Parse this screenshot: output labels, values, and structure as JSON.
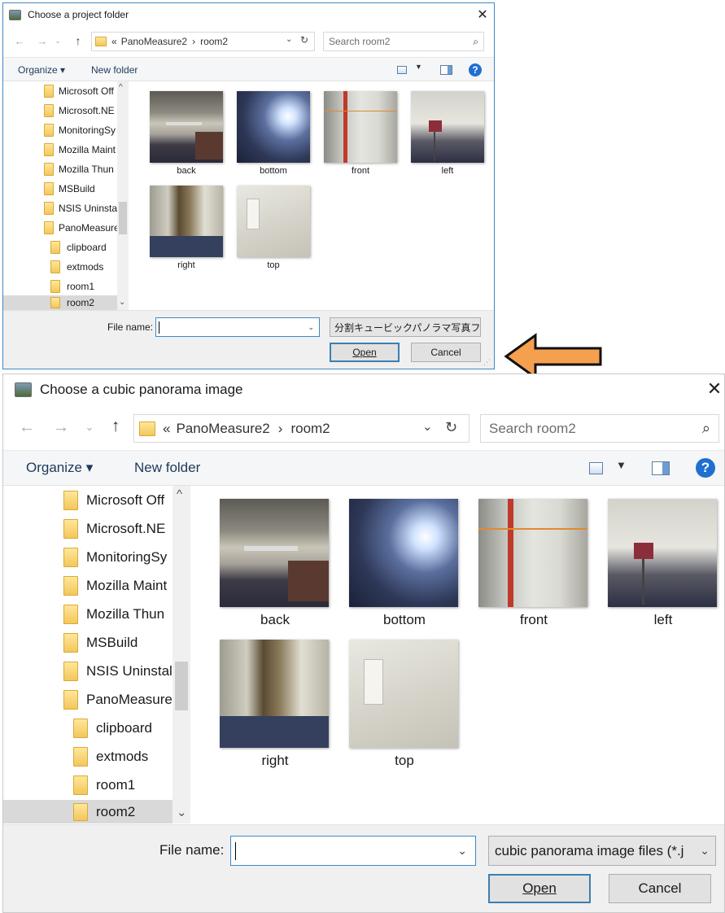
{
  "dialog_small": {
    "title": "Choose a project folder",
    "breadcrumb": [
      "«",
      "PanoMeasure2",
      "›",
      "room2"
    ],
    "search_placeholder": "Search room2",
    "toolbar": {
      "organize": "Organize ▾",
      "new_folder": "New folder"
    },
    "tree": [
      "Microsoft Off",
      "Microsoft.NE",
      "MonitoringSy",
      "Mozilla Maint",
      "Mozilla Thun",
      "MSBuild",
      "NSIS Uninstal",
      "PanoMeasure",
      "clipboard",
      "extmods",
      "room1",
      "room2"
    ],
    "files": [
      "back",
      "bottom",
      "front",
      "left",
      "right",
      "top"
    ],
    "filename_label": "File name:",
    "filename_value": "",
    "filetype": "分割キュービックパノラマ写真ファ",
    "open": "Open",
    "cancel": "Cancel"
  },
  "dialog_large": {
    "title": "Choose a cubic panorama image",
    "breadcrumb": [
      "«",
      "PanoMeasure2",
      "›",
      "room2"
    ],
    "search_placeholder": "Search room2",
    "toolbar": {
      "organize": "Organize ▾",
      "new_folder": "New folder"
    },
    "tree": [
      "Microsoft Off",
      "Microsoft.NE",
      "MonitoringSy",
      "Mozilla Maint",
      "Mozilla Thun",
      "MSBuild",
      "NSIS Uninstal",
      "PanoMeasure",
      "clipboard",
      "extmods",
      "room1",
      "room2"
    ],
    "files": [
      "back",
      "bottom",
      "front",
      "left",
      "right",
      "top"
    ],
    "filename_label": "File name:",
    "filename_value": "",
    "filetype": "cubic panorama image files (*.j",
    "open": "Open",
    "cancel": "Cancel"
  },
  "icons": {
    "close": "close-icon",
    "back": "back-arrow-icon",
    "forward": "forward-arrow-icon",
    "up": "up-arrow-icon",
    "refresh": "refresh-icon",
    "search": "search-icon",
    "help": "help-icon",
    "folder": "folder-icon",
    "annotation_arrow": "orange-left-arrow-icon"
  },
  "colors": {
    "accent": "#3f88c5",
    "annotation_arrow": "#f5a04f",
    "help": "#1f6fd1",
    "folder": "#f3c75b"
  }
}
